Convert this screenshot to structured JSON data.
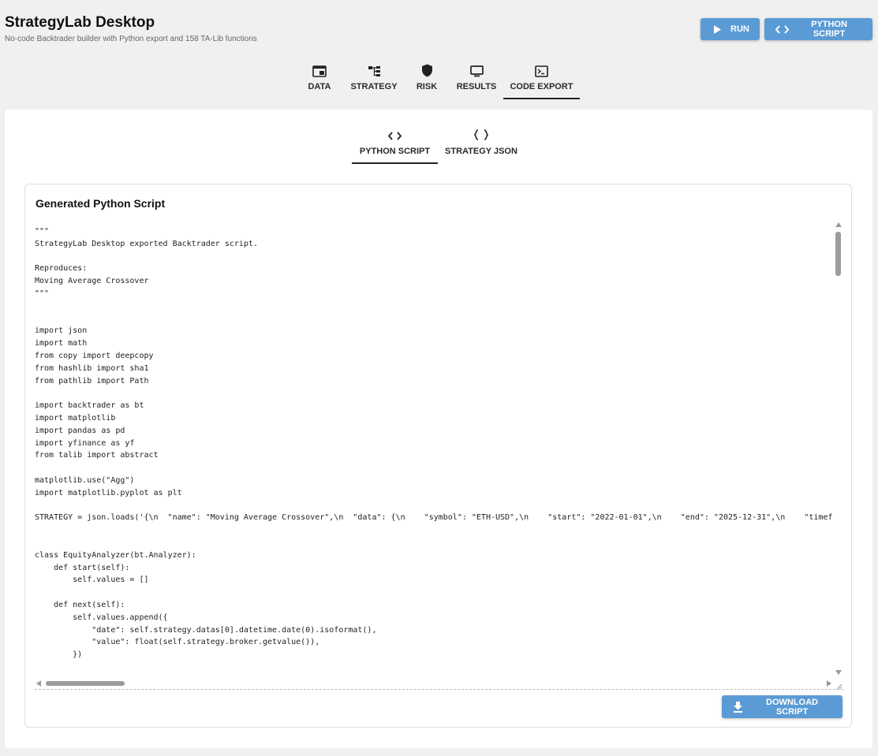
{
  "app": {
    "title": "StrategyLab Desktop",
    "subtitle": "No-code Backtrader builder with Python export and 158 TA-Lib functions"
  },
  "header_actions": {
    "run_label": "RUN",
    "python_label": "PYTHON SCRIPT"
  },
  "main_tabs": [
    {
      "label": "DATA",
      "icon": "window-icon"
    },
    {
      "label": "STRATEGY",
      "icon": "tree-icon"
    },
    {
      "label": "RISK",
      "icon": "shield-icon"
    },
    {
      "label": "RESULTS",
      "icon": "monitor-icon"
    },
    {
      "label": "CODE EXPORT",
      "icon": "terminal-icon",
      "active": true
    }
  ],
  "sub_tabs": [
    {
      "label": "PYTHON SCRIPT",
      "icon": "code-icon",
      "active": true
    },
    {
      "label": "STRATEGY JSON",
      "icon": "braces-icon"
    }
  ],
  "card": {
    "title": "Generated Python Script",
    "download_label": "DOWNLOAD SCRIPT"
  },
  "code": "\"\"\"\nStrategyLab Desktop exported Backtrader script.\n\nReproduces:\nMoving Average Crossover\n\"\"\"\n\n\nimport json\nimport math\nfrom copy import deepcopy\nfrom hashlib import sha1\nfrom pathlib import Path\n\nimport backtrader as bt\nimport matplotlib\nimport pandas as pd\nimport yfinance as yf\nfrom talib import abstract\n\nmatplotlib.use(\"Agg\")\nimport matplotlib.pyplot as plt\n\nSTRATEGY = json.loads('{\\n  \"name\": \"Moving Average Crossover\",\\n  \"data\": {\\n    \"symbol\": \"ETH-USD\",\\n    \"start\": \"2022-01-01\",\\n    \"end\": \"2025-12-31\",\\n    \"timeframe\n\n\nclass EquityAnalyzer(bt.Analyzer):\n    def start(self):\n        self.values = []\n\n    def next(self):\n        self.values.append({\n            \"date\": self.strategy.datas[0].datetime.date(0).isoformat(),\n            \"value\": float(self.strategy.broker.getvalue()),\n        })\n\n    def get_analysis(self):",
  "colors": {
    "accent": "#5b9bd5",
    "background": "#f0f0f0",
    "panel": "#ffffff"
  }
}
